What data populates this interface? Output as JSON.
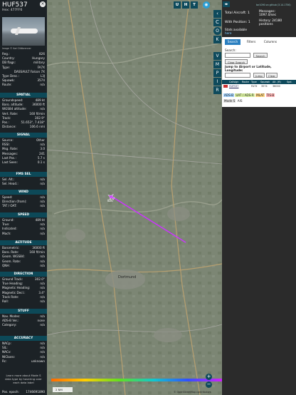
{
  "aircraft": {
    "callsign": "HUF537",
    "hex_label": "Hex:",
    "hex": "477FF6",
    "photo_credit": "Image © Karl Dittbrenner"
  },
  "details": [
    {
      "k": "Reg.:",
      "v": "826"
    },
    {
      "k": "Country:",
      "v": "Hungary"
    },
    {
      "k": "DB flags:",
      "v": "military"
    },
    {
      "k": "Type:",
      "v": "FA7X"
    },
    {
      "k": "",
      "v": "DASSAULT Falcon 7X"
    },
    {
      "k": "Type Desc.:",
      "v": "L3J"
    },
    {
      "k": "Squawk:",
      "v": "3574"
    },
    {
      "k": "Route:",
      "v": "n/a"
    }
  ],
  "spatial_title": "SPATIAL",
  "spatial": [
    {
      "k": "Groundspeed:",
      "v": "489 kt"
    },
    {
      "k": "Baro. altitude:",
      "v": "36000 ft"
    },
    {
      "k": "WGS84 altitude:",
      "v": "n/a"
    },
    {
      "k": "Vert. Rate:",
      "v": "160 ft/min"
    },
    {
      "k": "Track:",
      "v": "302.9°"
    },
    {
      "k": "Pos.:",
      "v": "51.653°, 7.418°"
    },
    {
      "k": "Distance:",
      "v": "106.6 nmi"
    }
  ],
  "signal_title": "SIGNAL",
  "signal": [
    {
      "k": "Source:",
      "v": "Other"
    },
    {
      "k": "RSSI:",
      "v": "n/a"
    },
    {
      "k": "Msg. Rate:",
      "v": "3.0"
    },
    {
      "k": "Messages:",
      "v": "241"
    },
    {
      "k": "Last Pos.:",
      "v": "5.7 s"
    },
    {
      "k": "Last Seen:",
      "v": "0.1 s"
    }
  ],
  "fms_title": "FMS SEL",
  "fms": [
    {
      "k": "Sel. Alt.:",
      "v": "n/a"
    },
    {
      "k": "Sel. Head.:",
      "v": "n/a"
    }
  ],
  "wind_title": "WIND",
  "wind": [
    {
      "k": "Speed:",
      "v": "n/a"
    },
    {
      "k": "Direction (from):",
      "v": "n/a"
    },
    {
      "k": "TAT / OAT:",
      "v": "n/a"
    }
  ],
  "speed_title": "SPEED",
  "speed": [
    {
      "k": "Ground:",
      "v": "489 kt"
    },
    {
      "k": "True:",
      "v": "n/a"
    },
    {
      "k": "Indicated:",
      "v": "n/a"
    },
    {
      "k": "Mach:",
      "v": "n/a"
    }
  ],
  "altitude_title": "ALTITUDE",
  "altitude": [
    {
      "k": "Barometric:",
      "v": "36000 ft"
    },
    {
      "k": "Baro. Rate:",
      "v": "160 ft/min"
    },
    {
      "k": "Geom. WGS84:",
      "v": "n/a"
    },
    {
      "k": "Geom. Rate:",
      "v": "n/a"
    },
    {
      "k": "QNH:",
      "v": "n/a"
    }
  ],
  "direction_title": "DIRECTION",
  "direction": [
    {
      "k": "Ground Track:",
      "v": "302.0°"
    },
    {
      "k": "True Heading:",
      "v": "n/a"
    },
    {
      "k": "Magnetic Heading:",
      "v": "n/a"
    },
    {
      "k": "Magnetic Decl.:",
      "v": "3.4°"
    },
    {
      "k": "Track Rate:",
      "v": "n/a"
    },
    {
      "k": "Roll:",
      "v": "n/a"
    }
  ],
  "stuff_title": "STUFF",
  "stuff": [
    {
      "k": "Nav. Modes:",
      "v": "n/a"
    },
    {
      "k": "ADS-B Ver.:",
      "v": "none"
    },
    {
      "k": "Category:",
      "v": "n/a"
    }
  ],
  "accuracy_title": "ACCURACY",
  "accuracy": [
    {
      "k": "NACp:",
      "v": "n/a"
    },
    {
      "k": "SIL:",
      "v": "n/a"
    },
    {
      "k": "NACv:",
      "v": "n/a"
    },
    {
      "k": "NICbaro:",
      "v": "n/a"
    },
    {
      "k": "Rc:",
      "v": "unknown"
    }
  ],
  "note": "Learn more about Mode S data type by hovering over each data label",
  "pos_epoch_label": "Pos. epoch:",
  "pos_epoch": "1746691890",
  "toolbar_top": [
    "U",
    "H",
    "T"
  ],
  "toolbar_side": [
    "C",
    "O",
    "K",
    "V",
    "M",
    "P",
    "I",
    "R"
  ],
  "stats": {
    "version": "tar1090 on github (3.14.1756)",
    "total_label": "Total Aircraft:",
    "total": "1",
    "with_pos_label": "With Position:",
    "with_pos": "1",
    "messages_label": "Messages:",
    "messages": "1097.0/sec",
    "history_label": "History:",
    "history": "24180 positions",
    "stats_label": "Stats available",
    "stats_link": "here"
  },
  "tabs": [
    "Search",
    "Filters",
    "Columns"
  ],
  "search": {
    "label": "Search:",
    "button": "Search",
    "clear": "Clear Search",
    "jump_label": "Jump to Airport or Latitude, Longitude:",
    "jump_btn": "Jump",
    "clear_btn": "Clear"
  },
  "table_headers": [
    "Callsign",
    "Route",
    "Type",
    "Squawk",
    "Alt. (ft)",
    "Spd."
  ],
  "table_row": [
    "HUF537",
    "",
    "FA7X",
    "3574",
    "36000",
    ""
  ],
  "legend": [
    "ADS-B",
    "UAT / ADS-R",
    "MLAT",
    "TIS-B",
    "Mode S",
    "AIS"
  ],
  "map": {
    "scale": "2 NM",
    "attribution": "© OpenStreetMap contributors",
    "city": "Dortmund",
    "aircraft_label": "826"
  }
}
